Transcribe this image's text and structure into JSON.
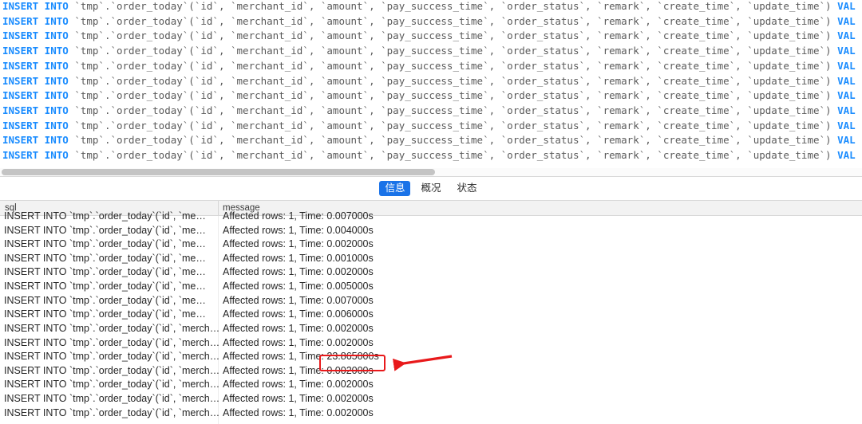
{
  "editor": {
    "language": "sql",
    "keyword": "INSERT INTO",
    "statement_tail": " `tmp`.`order_today`(`id`, `merchant_id`, `amount`, `pay_success_time`, `order_status`, `remark`, `create_time`, `update_time`) ",
    "keyword_tail": "VAL",
    "line_count": 11,
    "lines": [
      {
        "kw": "INSERT INTO",
        "body": " `tmp`.`order_today`(`id`, `merchant_id`, `amount`, `pay_success_time`, `order_status`, `remark`, `create_time`, `update_time`) ",
        "kw2": "VAL"
      },
      {
        "kw": "INSERT INTO",
        "body": " `tmp`.`order_today`(`id`, `merchant_id`, `amount`, `pay_success_time`, `order_status`, `remark`, `create_time`, `update_time`) ",
        "kw2": "VAL"
      },
      {
        "kw": "INSERT INTO",
        "body": " `tmp`.`order_today`(`id`, `merchant_id`, `amount`, `pay_success_time`, `order_status`, `remark`, `create_time`, `update_time`) ",
        "kw2": "VAL"
      },
      {
        "kw": "INSERT INTO",
        "body": " `tmp`.`order_today`(`id`, `merchant_id`, `amount`, `pay_success_time`, `order_status`, `remark`, `create_time`, `update_time`) ",
        "kw2": "VAL"
      },
      {
        "kw": "INSERT INTO",
        "body": " `tmp`.`order_today`(`id`, `merchant_id`, `amount`, `pay_success_time`, `order_status`, `remark`, `create_time`, `update_time`) ",
        "kw2": "VAL"
      },
      {
        "kw": "INSERT INTO",
        "body": " `tmp`.`order_today`(`id`, `merchant_id`, `amount`, `pay_success_time`, `order_status`, `remark`, `create_time`, `update_time`) ",
        "kw2": "VAL"
      },
      {
        "kw": "INSERT INTO",
        "body": " `tmp`.`order_today`(`id`, `merchant_id`, `amount`, `pay_success_time`, `order_status`, `remark`, `create_time`, `update_time`) ",
        "kw2": "VAL"
      },
      {
        "kw": "INSERT INTO",
        "body": " `tmp`.`order_today`(`id`, `merchant_id`, `amount`, `pay_success_time`, `order_status`, `remark`, `create_time`, `update_time`) ",
        "kw2": "VAL"
      },
      {
        "kw": "INSERT INTO",
        "body": " `tmp`.`order_today`(`id`, `merchant_id`, `amount`, `pay_success_time`, `order_status`, `remark`, `create_time`, `update_time`) ",
        "kw2": "VAL"
      },
      {
        "kw": "INSERT INTO",
        "body": " `tmp`.`order_today`(`id`, `merchant_id`, `amount`, `pay_success_time`, `order_status`, `remark`, `create_time`, `update_time`) ",
        "kw2": "VAL"
      },
      {
        "kw": "INSERT INTO",
        "body": " `tmp`.`order_today`(`id`, `merchant_id`, `amount`, `pay_success_time`, `order_status`, `remark`, `create_time`, `update_time`) ",
        "kw2": "VAL"
      }
    ]
  },
  "tabs": [
    {
      "label": "信息",
      "active": true
    },
    {
      "label": "概况",
      "active": false
    },
    {
      "label": "状态",
      "active": false
    }
  ],
  "grid": {
    "columns": [
      "sql",
      "message"
    ],
    "rows": [
      {
        "sql": "INSERT INTO `tmp`.`order_today`(`id`, `me…",
        "message": "Affected rows: 1, Time: 0.007000s",
        "highlight": false
      },
      {
        "sql": "INSERT INTO `tmp`.`order_today`(`id`, `me…",
        "message": "Affected rows: 1, Time: 0.004000s",
        "highlight": false
      },
      {
        "sql": "INSERT INTO `tmp`.`order_today`(`id`, `me…",
        "message": "Affected rows: 1, Time: 0.002000s",
        "highlight": false
      },
      {
        "sql": "INSERT INTO `tmp`.`order_today`(`id`, `me…",
        "message": "Affected rows: 1, Time: 0.001000s",
        "highlight": false
      },
      {
        "sql": "INSERT INTO `tmp`.`order_today`(`id`, `me…",
        "message": "Affected rows: 1, Time: 0.002000s",
        "highlight": false
      },
      {
        "sql": "INSERT INTO `tmp`.`order_today`(`id`, `me…",
        "message": "Affected rows: 1, Time: 0.005000s",
        "highlight": false
      },
      {
        "sql": "INSERT INTO `tmp`.`order_today`(`id`, `me…",
        "message": "Affected rows: 1, Time: 0.007000s",
        "highlight": false
      },
      {
        "sql": "INSERT INTO `tmp`.`order_today`(`id`, `me…",
        "message": "Affected rows: 1, Time: 0.006000s",
        "highlight": false
      },
      {
        "sql": "INSERT INTO `tmp`.`order_today`(`id`, `merch…",
        "message": "Affected rows: 1, Time: 0.002000s",
        "highlight": false
      },
      {
        "sql": "INSERT INTO `tmp`.`order_today`(`id`, `merch…",
        "message": "Affected rows: 1, Time: 0.002000s",
        "highlight": false
      },
      {
        "sql": "INSERT INTO `tmp`.`order_today`(`id`, `merch…",
        "message": "Affected rows: 1, Time: 23.865000s",
        "highlight": true
      },
      {
        "sql": "INSERT INTO `tmp`.`order_today`(`id`, `merch…",
        "message": "Affected rows: 1, Time: 0.002000s",
        "highlight": false
      },
      {
        "sql": "INSERT INTO `tmp`.`order_today`(`id`, `merch…",
        "message": "Affected rows: 1, Time: 0.002000s",
        "highlight": false
      },
      {
        "sql": "INSERT INTO `tmp`.`order_today`(`id`, `merch…",
        "message": "Affected rows: 1, Time: 0.002000s",
        "highlight": false
      },
      {
        "sql": "INSERT INTO `tmp`.`order_today`(`id`, `merch…",
        "message": "Affected rows: 1, Time: 0.002000s",
        "highlight": false
      }
    ]
  },
  "annotation": {
    "highlighted_value": "23.865000s",
    "box_color": "#e8191b",
    "arrow_color": "#e8191b",
    "arrow_direction": "left"
  },
  "colors": {
    "keyword": "#1a8cff",
    "tab_active_bg": "#1a73e8",
    "grid_header_bg": "#f2f2f2",
    "annotation": "#e8191b"
  }
}
